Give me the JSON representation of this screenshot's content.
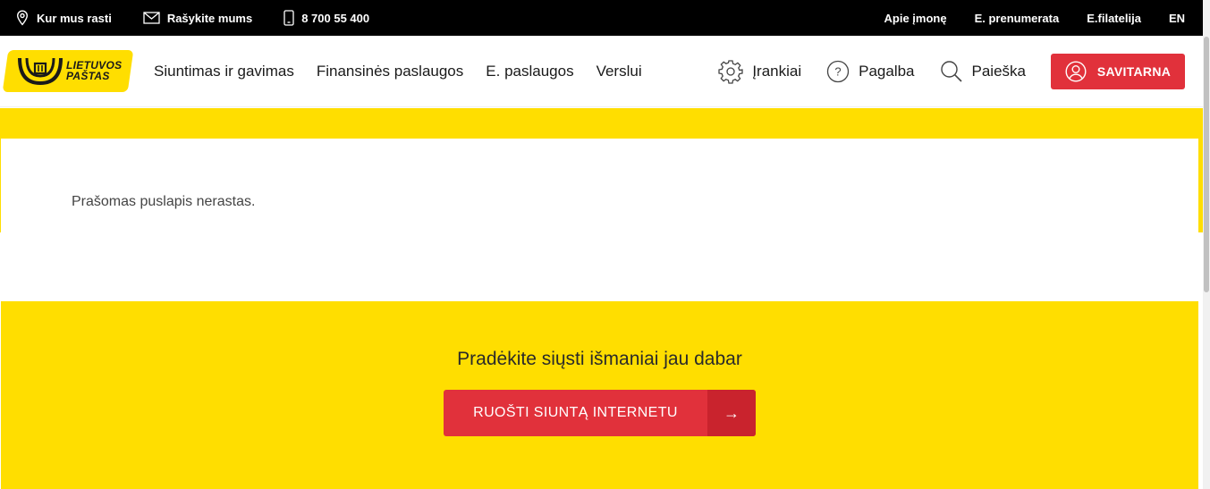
{
  "topbar": {
    "left": [
      {
        "icon": "location-pin-icon",
        "label": "Kur mus rasti"
      },
      {
        "icon": "envelope-icon",
        "label": "Rašykite mums"
      },
      {
        "icon": "phone-icon",
        "label": "8 700 55 400"
      }
    ],
    "right": [
      "Apie įmonę",
      "E. prenumerata",
      "E.filatelija",
      "EN"
    ]
  },
  "header": {
    "logo_line1": "LIETUVOS",
    "logo_line2": "PAŠTAS",
    "nav": [
      "Siuntimas ir gavimas",
      "Finansinės paslaugos",
      "E. paslaugos",
      "Verslui"
    ],
    "tools": [
      {
        "icon": "gear-icon",
        "label": "Įrankiai"
      },
      {
        "icon": "help-circle-icon",
        "label": "Pagalba"
      },
      {
        "icon": "search-icon",
        "label": "Paieška"
      }
    ],
    "account_button": "SAVITARNA"
  },
  "main": {
    "message": "Prašomas puslapis nerastas."
  },
  "cta": {
    "heading": "Pradėkite siųsti išmaniai jau dabar",
    "button_label": "RUOŠTI SIUNTĄ INTERNETU",
    "button_arrow": "→"
  },
  "colors": {
    "brand_yellow": "#ffde00",
    "brand_red": "#e1313b",
    "topbar_bg": "#000000"
  }
}
